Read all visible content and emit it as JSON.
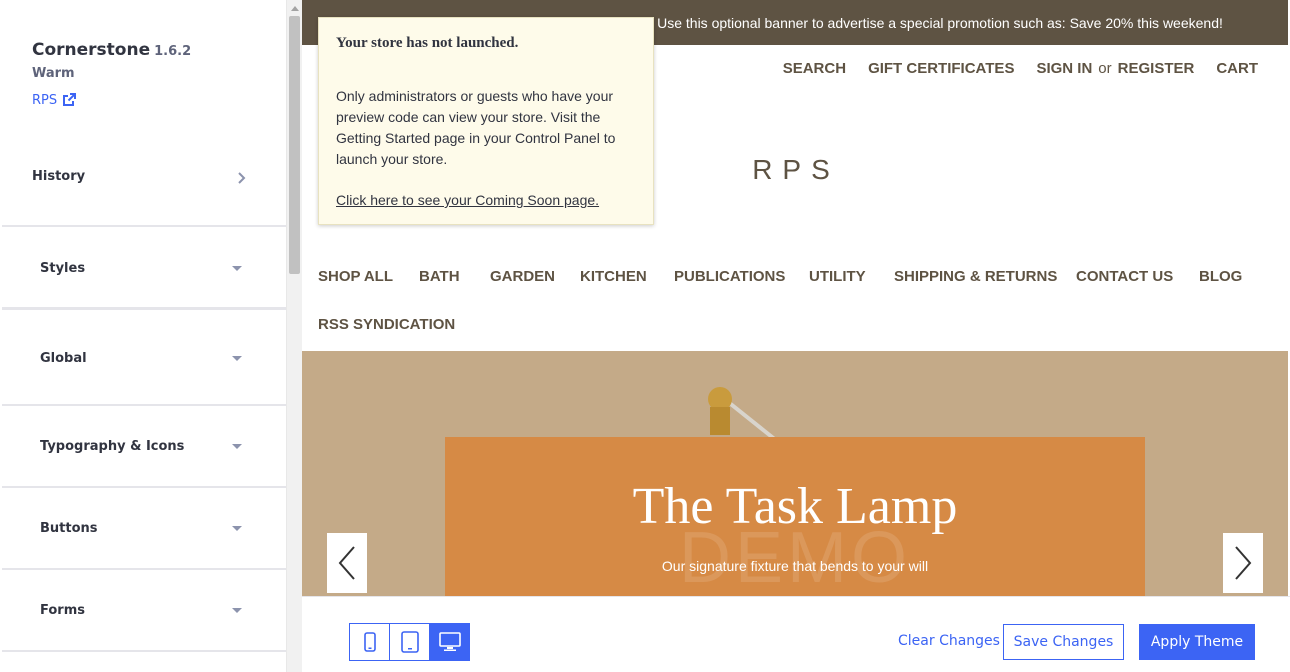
{
  "sidebar": {
    "theme_name": "Cornerstone",
    "theme_version": "1.6.2",
    "theme_variant": "Warm",
    "store_link": "RPS",
    "history_label": "History",
    "sections": [
      {
        "label": "Styles"
      },
      {
        "label": "Global"
      },
      {
        "label": "Typography & Icons"
      },
      {
        "label": "Buttons"
      },
      {
        "label": "Forms"
      }
    ]
  },
  "preview": {
    "banner_text": "Use this optional banner to advertise a special promotion such as: Save 20% this weekend!",
    "top_nav": {
      "search": "SEARCH",
      "gift": "GIFT CERTIFICATES",
      "sign_in": "SIGN IN",
      "or": "or",
      "register": "REGISTER",
      "cart": "CART"
    },
    "logo": "RPS",
    "main_nav": [
      "SHOP ALL",
      "BATH",
      "GARDEN",
      "KITCHEN",
      "PUBLICATIONS",
      "UTILITY",
      "SHIPPING & RETURNS",
      "CONTACT US",
      "BLOG",
      "RSS SYNDICATION"
    ],
    "hero": {
      "title": "The Task Lamp",
      "subtitle": "Our signature fixture that bends to your will",
      "watermark": "DEMO"
    }
  },
  "notice": {
    "title": "Your store has not launched.",
    "body": "Only administrators or guests who have your preview code can view your store. Visit the Getting Started page in your Control Panel to launch your store.",
    "link": "Click here to see your Coming Soon page."
  },
  "toolbar": {
    "clear": "Clear Changes",
    "save": "Save Changes",
    "apply": "Apply Theme"
  },
  "colors": {
    "accent": "#3c64f4",
    "banner": "#5e5343",
    "hero_bg": "#c4aa88",
    "hero_card": "#d68a45",
    "notice_bg": "#fefbea"
  }
}
